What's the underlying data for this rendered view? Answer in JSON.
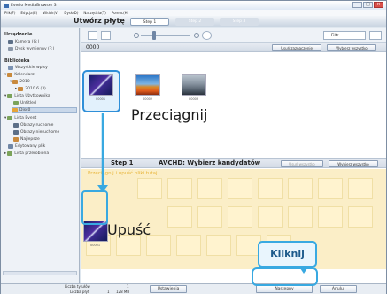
{
  "window": {
    "title": "Everio MediaBrowser 3"
  },
  "menubar": {
    "items": [
      "Plik(F)",
      "Edycja(E)",
      "Widok(V)",
      "Dysk(D)",
      "Narzędzia(T)",
      "Pomoc(H)"
    ]
  },
  "header": {
    "title": "Utwórz płytę",
    "steps": [
      "Step 1",
      "Step 2",
      "Step 3"
    ]
  },
  "sidebar": {
    "devices_heading": "Urządzenie",
    "devices": [
      "Kamera (G:)",
      "Dysk wymienny (F:)"
    ],
    "library_heading": "Biblioteka",
    "library": [
      "Wszystkie wpisy",
      "Kalendarz",
      "2010",
      "2010.6 (3)",
      "Lista Użytkownika",
      "Untitled",
      "Disc0",
      "Lista Event",
      "Obrazy ruchome",
      "Obrazy nieruchome",
      "Najlepsze",
      "Edytowany plik",
      "Lista przerobiona"
    ]
  },
  "toolbar": {
    "filter_label": "Filtr"
  },
  "group": {
    "title": "0000",
    "btn_deselect": "Usuń zaznaczenie",
    "btn_select_all": "Wybierz wszystko"
  },
  "thumbs": [
    "00001",
    "00002",
    "00003"
  ],
  "instructions": {
    "drag": "Przeciągnij",
    "drop": "Upuść",
    "click": "Kliknij"
  },
  "candidates": {
    "step_label": "Step 1",
    "step_desc": "AVCHD: Wybierz kandydatów",
    "btn_deselect_all": "Usuń wszystko",
    "btn_select_all": "Wybierz wszystko",
    "drop_hint": "Przeciągnij i upuść pliki tutaj.",
    "item_caption": "00001"
  },
  "bottom": {
    "count_label": "Liczba tytułów",
    "count_value": "1",
    "discs_label": "Liczba płyt",
    "discs_value": "1",
    "size_value": "128 MB",
    "settings_btn": "Ustawienia",
    "next_btn": "Następny",
    "cancel_btn": "Anuluj"
  },
  "colors": {
    "accent": "#39a9e1",
    "candidate_area": "#fbeec7"
  }
}
